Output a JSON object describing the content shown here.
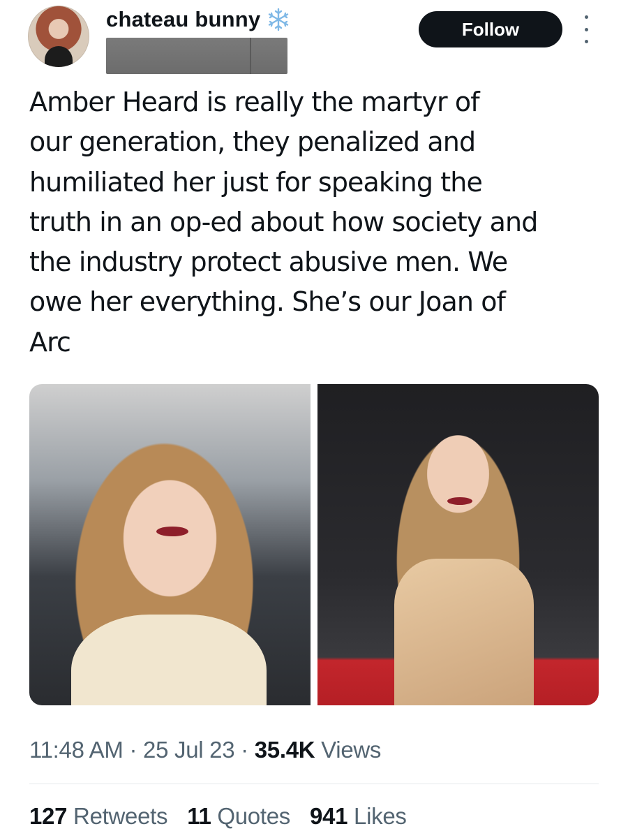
{
  "author": {
    "display_name": "chateau bunny",
    "badge_icon": "snowflake-icon"
  },
  "follow_label": "Follow",
  "tweet": {
    "text": "Amber Heard is really the martyr of\nour generation, they penalized and\nhumiliated her just for speaking the\ntruth in an op-ed about how society and\nthe industry protect abusive men. We\nowe her everything. She’s our Joan of\nArc"
  },
  "meta": {
    "time": "11:48 AM",
    "date": "25 Jul 23",
    "views_count": "35.4K",
    "views_label": "Views",
    "separator": "·"
  },
  "stats": {
    "retweets_count": "127",
    "retweets_label": "Retweets",
    "quotes_count": "11",
    "quotes_label": "Quotes",
    "likes_count": "941",
    "likes_label": "Likes"
  },
  "colors": {
    "text": "#0f1419",
    "secondary": "#536471",
    "button_bg": "#0f1419",
    "badge": "#7fb8e6"
  }
}
